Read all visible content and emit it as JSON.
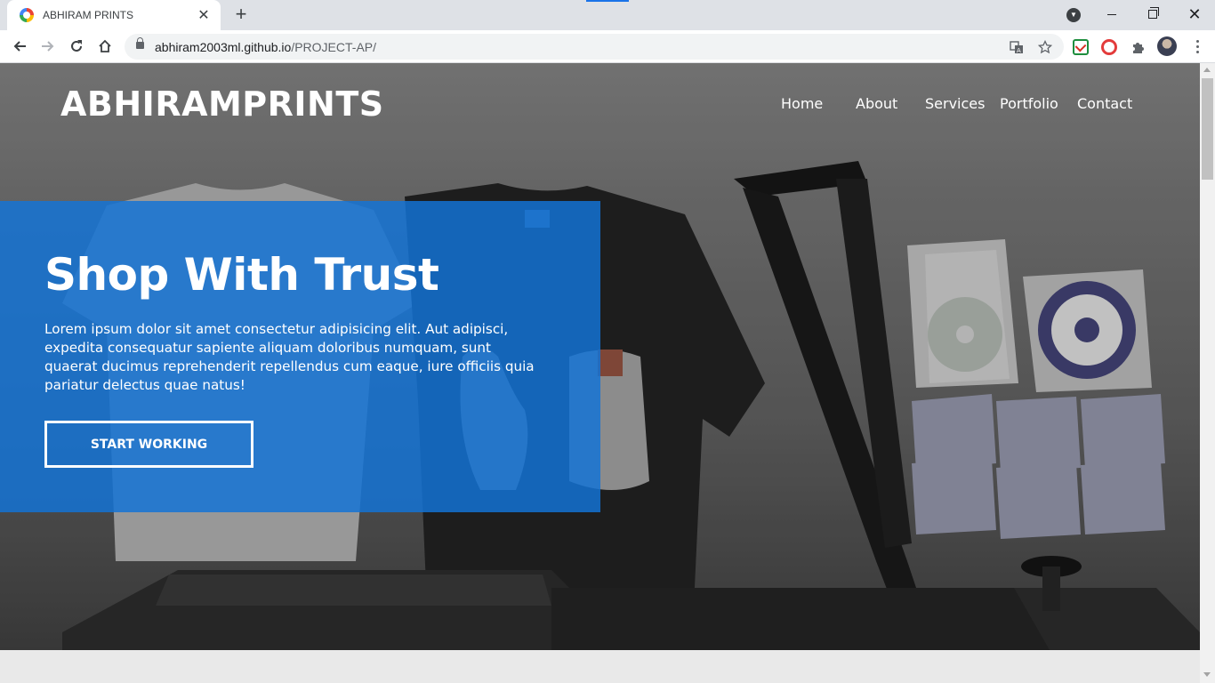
{
  "browser": {
    "tab": {
      "title": "ABHIRAM PRINTS",
      "favicon": "chrome-favicon-icon",
      "close": "✕"
    },
    "new_tab": "+",
    "address": {
      "host": "abhiram2003ml.github.io",
      "path": "/PROJECT-AP/"
    },
    "window_controls": [
      "minimize-icon",
      "restore-icon",
      "close-icon"
    ],
    "close_glyph": "✕",
    "accent": "#1a73e8"
  },
  "site": {
    "brand": "ABHIRAMPRINTS",
    "nav": [
      "Home",
      "About",
      "Services",
      "Portfolio",
      "Contact"
    ],
    "hero": {
      "title": "Shop With Trust",
      "text": "Lorem ipsum dolor sit amet consectetur adipisicing elit. Aut adipisci, expedita consequatur sapiente aliquam doloribus numquam, sunt quaerat ducimus reprehenderit repellendus cum eaque, iure officiis quia pariatur delectus quae natus!",
      "cta": "START WORKING",
      "card_color": "#1373d6"
    }
  }
}
